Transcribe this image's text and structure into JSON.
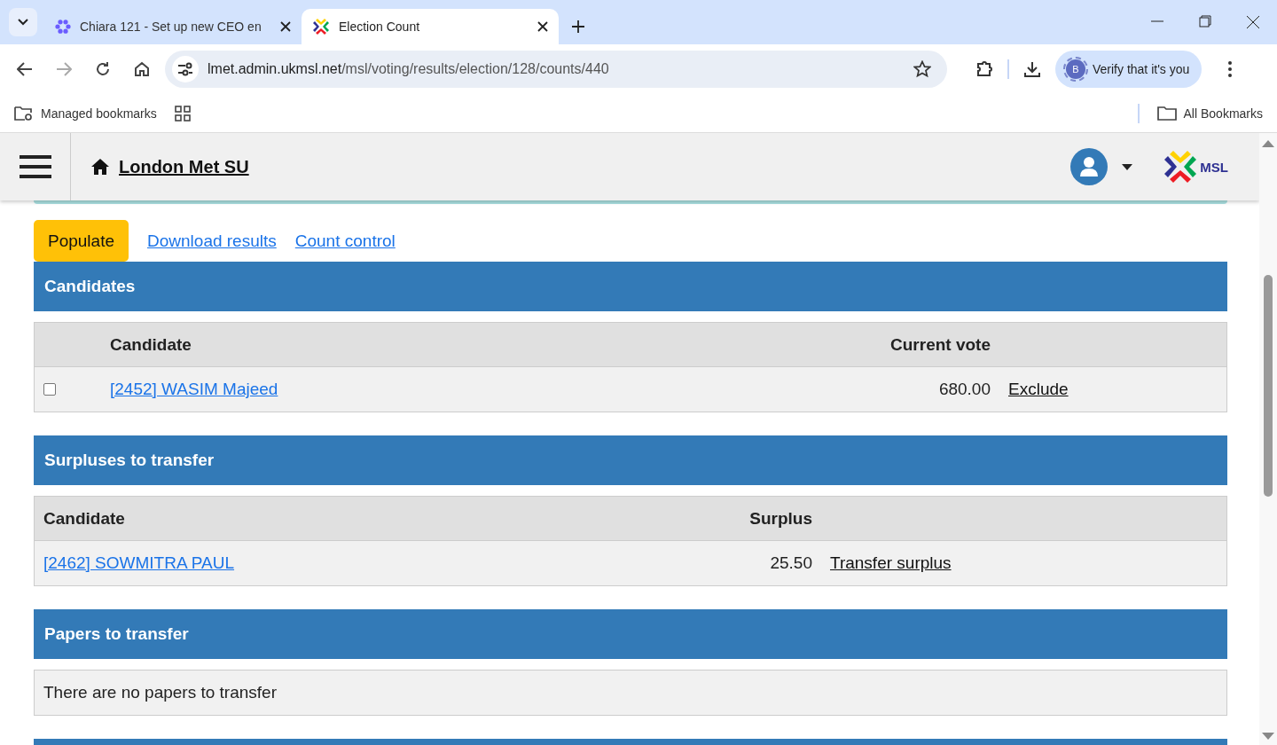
{
  "browser": {
    "tabs": [
      {
        "title": "Chiara 121 - Set up new CEO en",
        "selected": false,
        "kind": "flower"
      },
      {
        "title": "Election Count",
        "selected": true,
        "kind": "msl"
      }
    ],
    "address": {
      "host": "lmet.admin.ukmsl.net",
      "path": "/msl/voting/results/election/128/counts/440"
    },
    "profile": {
      "avatar": "B",
      "label": "Verify that it's you"
    },
    "bookmarks": [
      "Managed bookmarks"
    ],
    "all_bookmarks": "All Bookmarks"
  },
  "site": {
    "title": "London Met SU",
    "logo": "MSL"
  },
  "actions": [
    {
      "label": "Populate",
      "kind": "button"
    },
    {
      "label": "Download results",
      "kind": "link"
    },
    {
      "label": "Count control",
      "kind": "link"
    }
  ],
  "candidates": {
    "heading": "Candidates",
    "columns": [
      "Candidate",
      "Current vote"
    ],
    "rows": [
      {
        "checked": false,
        "candidate": "[2452] WASIM Majeed",
        "vote": "680.00",
        "action": "Exclude"
      }
    ]
  },
  "surpluses": {
    "heading": "Surpluses to transfer",
    "columns": [
      "Candidate",
      "Surplus"
    ],
    "rows": [
      {
        "candidate": "[2462] SOWMITRA PAUL",
        "surplus": "25.50",
        "action": "Transfer surplus"
      }
    ]
  },
  "papers": {
    "heading": "Papers to transfer",
    "message": "There are no papers to transfer"
  }
}
